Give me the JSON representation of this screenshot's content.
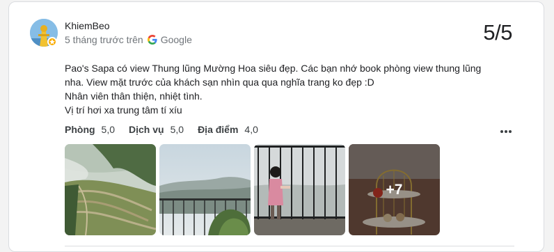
{
  "review": {
    "author": "KhiemBeo",
    "time_ago": "5 tháng trước trên",
    "source": "Google",
    "score": "5/5",
    "text_lines": [
      "Pao's Sapa có view Thung lũng Mường Hoa siêu đẹp. Các bạn nhớ book phòng view thung lũng",
      "nha. View mặt trước của khách sạn nhìn qua qua nghĩa trang ko đẹp :D",
      "Nhân viên thân thiện, nhiệt tình.",
      "Vị trí hơi xa trung tâm tí xíu"
    ],
    "ratings": [
      {
        "label": "Phòng",
        "value": "5,0"
      },
      {
        "label": "Dịch vụ",
        "value": "5,0"
      },
      {
        "label": "Địa điểm",
        "value": "4,0"
      }
    ],
    "photos_more": "+7"
  },
  "colors": {
    "accent_badge": "#f9ab00",
    "text_primary": "#202124",
    "text_secondary": "#70757a"
  },
  "icons": {
    "more": "more-horiz-icon",
    "google": "google-g-icon",
    "badge": "local-guide-star-icon"
  }
}
